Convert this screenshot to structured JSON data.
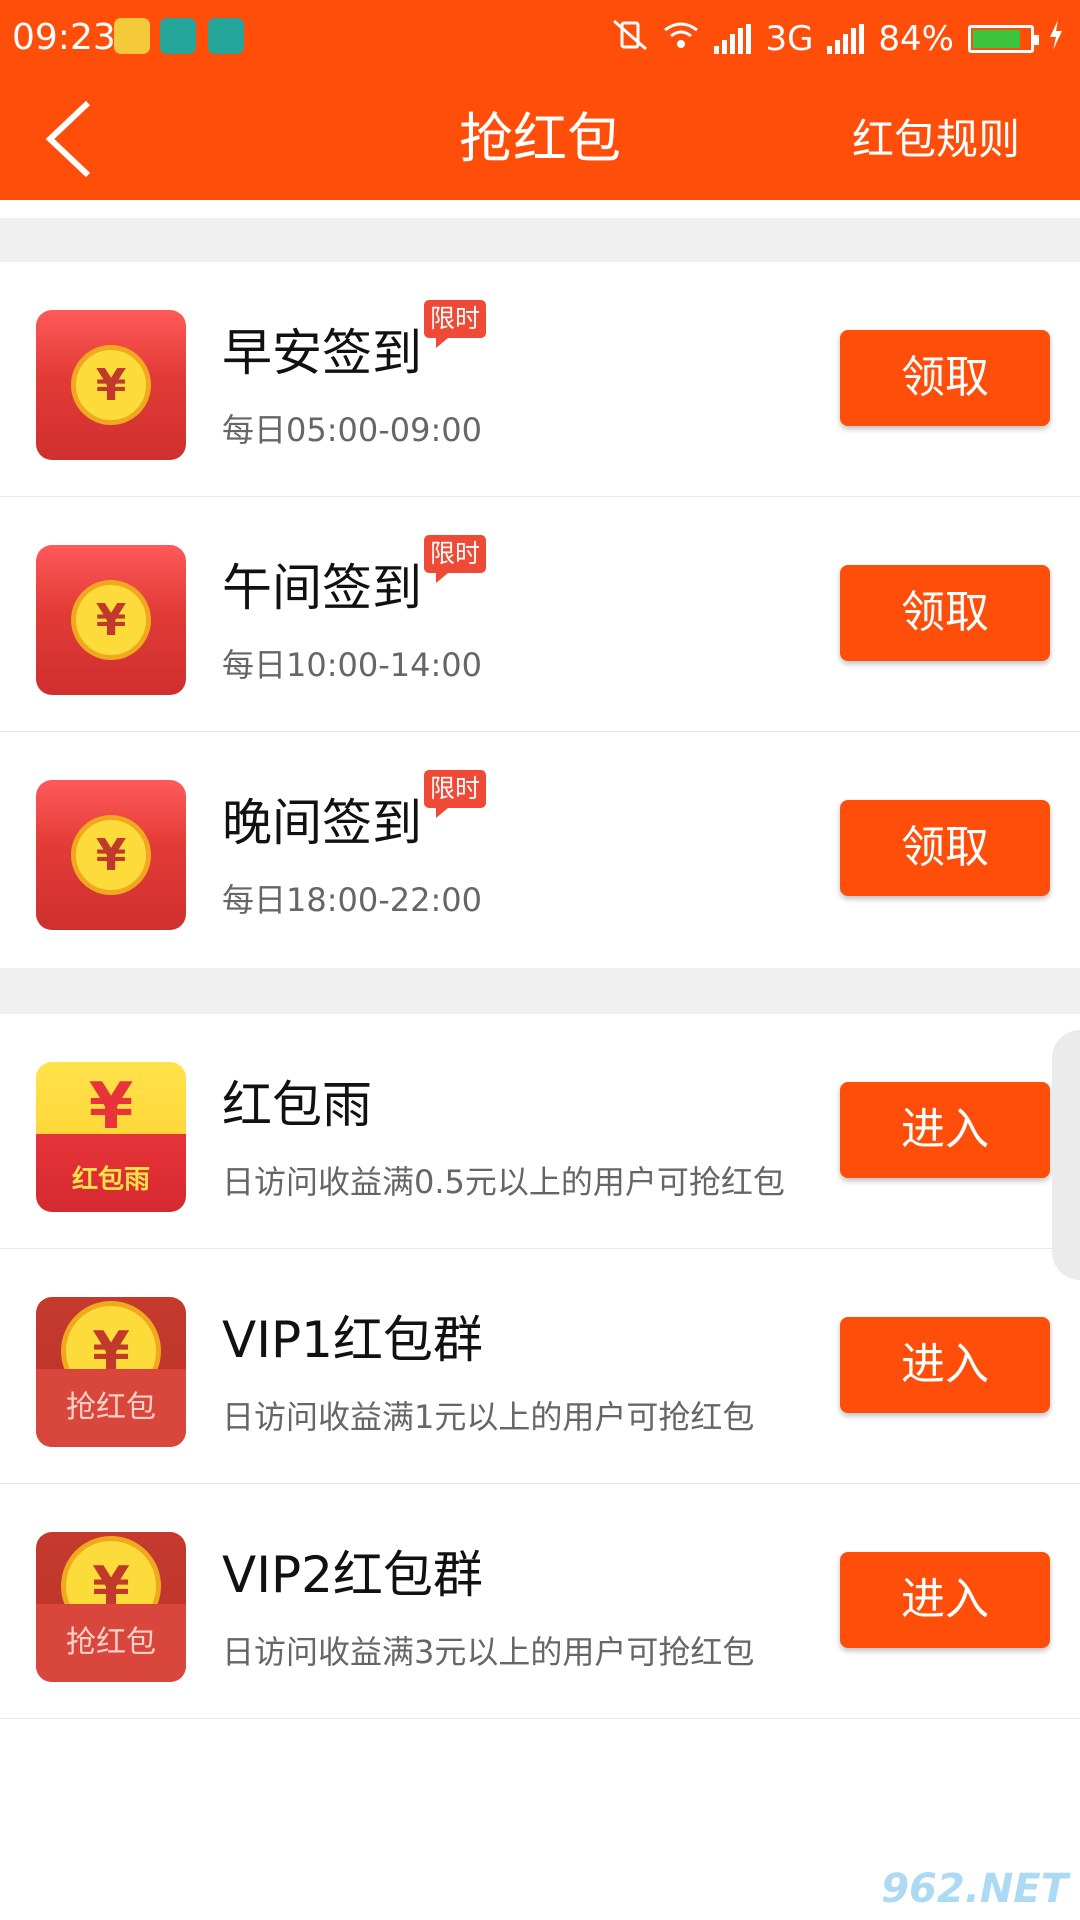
{
  "status_bar": {
    "time": "09:23",
    "network": "3G",
    "battery": "84%",
    "battery_level": 0.84,
    "icons": [
      "shield-app-icon",
      "scan-icon",
      "usb-icon",
      "vibrate-off-icon",
      "wifi-icon",
      "signal-icon",
      "battery-icon",
      "charging-icon"
    ]
  },
  "header": {
    "title": "抢红包",
    "rules_link": "红包规则",
    "back_icon": "back-arrow-icon",
    "background": "#ff4e0a"
  },
  "checkin": [
    {
      "title": "早安签到",
      "badge": "限时",
      "time": "每日05:00-09:00",
      "button": "领取"
    },
    {
      "title": "午间签到",
      "badge": "限时",
      "time": "每日10:00-14:00",
      "button": "领取"
    },
    {
      "title": "晚间签到",
      "badge": "限时",
      "time": "每日18:00-22:00",
      "button": "领取"
    }
  ],
  "groups": [
    {
      "title": "红包雨",
      "icon_label": "红包雨",
      "desc": "日访问收益满0.5元以上的用户可抢红包",
      "button": "进入"
    },
    {
      "title": "VIP1红包群",
      "icon_label": "抢红包",
      "desc": "日访问收益满1元以上的用户可抢红包",
      "button": "进入"
    },
    {
      "title": "VIP2红包群",
      "icon_label": "抢红包",
      "desc": "日访问收益满3元以上的用户可抢红包",
      "button": "进入"
    }
  ],
  "coin_symbol": "¥",
  "colors": {
    "accent": "#ff4e0a",
    "envelope_red": "#e23b36",
    "coin_gold": "#fddb3a",
    "badge_red": "#ef4a36"
  },
  "watermark": "962.NET"
}
